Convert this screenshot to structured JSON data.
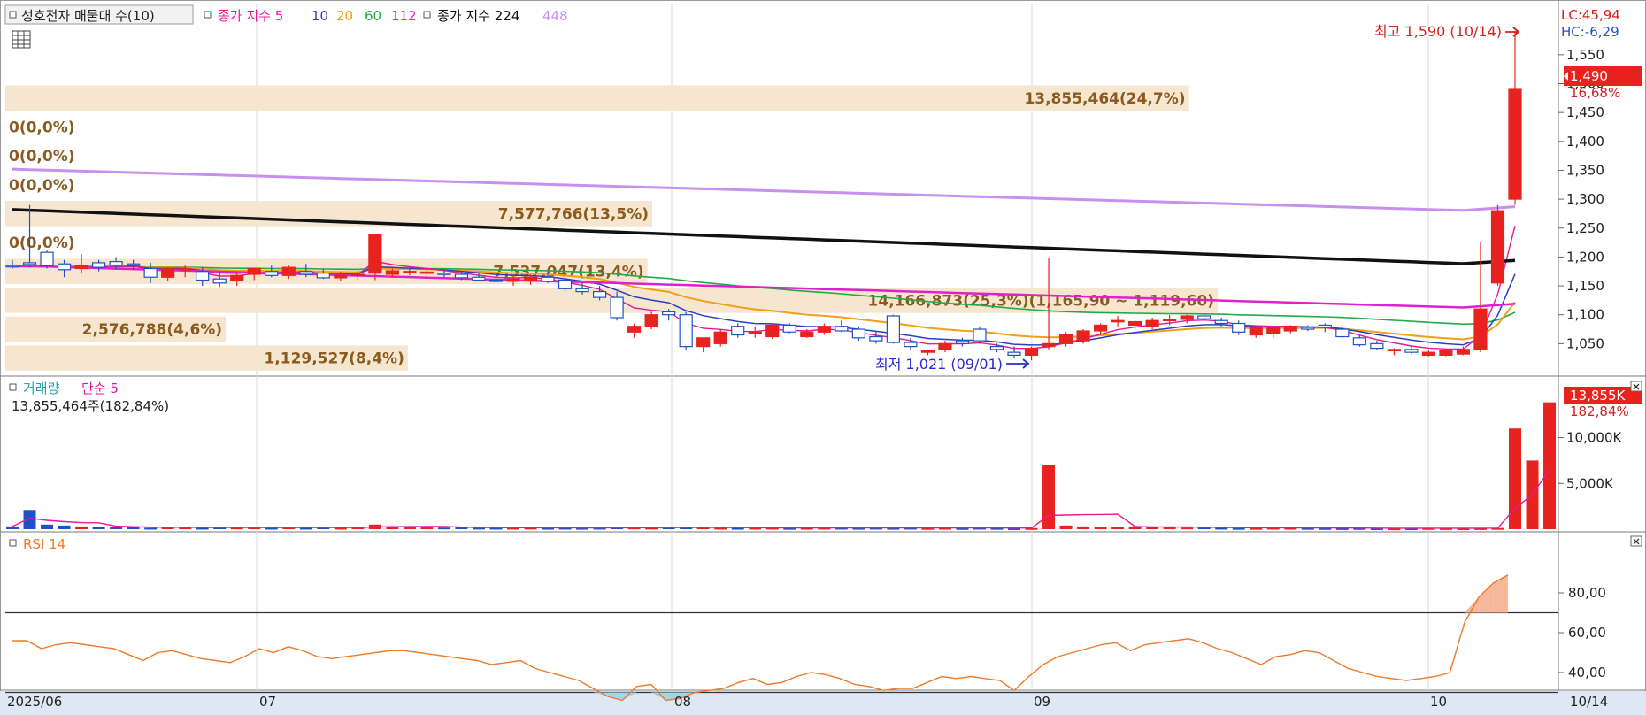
{
  "price_panel": {
    "title": "성호전자 매물대 수(10)",
    "ma_label": "종가 지수 5",
    "ma_periods": [
      "10",
      "20",
      "60",
      "112"
    ],
    "ma2_label": "종가 지수 224",
    "ma2_period": "448",
    "lc_label": "LC:45,94",
    "hc_label": "HC:-6,29",
    "current_price_label": "1,490",
    "current_change_label": "16,68%",
    "high_marker": "최고 1,590 (10/14)",
    "low_marker": "최저 1,021 (09/01)",
    "y_ticks": [
      "1,550",
      "1,500",
      "1,450",
      "1,400",
      "1,350",
      "1,300",
      "1,250",
      "1,200",
      "1,150",
      "1,100",
      "1,050"
    ]
  },
  "volume_panel": {
    "title": "거래량",
    "ma_label": "단순 5",
    "info": "13,855,464주(182,84%)",
    "current_label": "13,855K",
    "current_pct_label": "182,84%",
    "y_ticks": [
      "10,000K",
      "5,000K"
    ]
  },
  "rsi_panel": {
    "title": "RSI 14",
    "y_ticks": [
      "80,00",
      "60,00",
      "40,00"
    ]
  },
  "x_axis": {
    "labels": [
      "2025/06",
      "07",
      "08",
      "09",
      "10"
    ],
    "end_label": "10/14"
  },
  "colors": {
    "up": "#e8231f",
    "down": "#2050c8",
    "ma5": "#e8179b",
    "ma10": "#2a3fbf",
    "ma20": "#f0a018",
    "ma60": "#24a848",
    "ma112": "#e020d0",
    "ma224": "#111111",
    "ma448": "#c890ee",
    "profile": "#f6e6d0",
    "profile_text": "#8a5a1e",
    "rsi": "#f07a2a"
  },
  "chart_data": [
    {
      "type": "candlestick",
      "title": "성호전자 매물대 수(10)",
      "ylim": [
        1000,
        1600
      ],
      "x_labels": [
        "2025/06",
        "07",
        "08",
        "09",
        "10",
        "10/14"
      ],
      "candles": [
        {
          "o": 1185,
          "h": 1195,
          "l": 1180,
          "c": 1183
        },
        {
          "o": 1190,
          "h": 1290,
          "l": 1182,
          "c": 1187
        },
        {
          "o": 1208,
          "h": 1212,
          "l": 1180,
          "c": 1185
        },
        {
          "o": 1188,
          "h": 1195,
          "l": 1165,
          "c": 1178
        },
        {
          "o": 1180,
          "h": 1205,
          "l": 1172,
          "c": 1185
        },
        {
          "o": 1190,
          "h": 1195,
          "l": 1175,
          "c": 1182
        },
        {
          "o": 1192,
          "h": 1200,
          "l": 1178,
          "c": 1186
        },
        {
          "o": 1188,
          "h": 1195,
          "l": 1178,
          "c": 1185
        },
        {
          "o": 1180,
          "h": 1190,
          "l": 1155,
          "c": 1165
        },
        {
          "o": 1165,
          "h": 1182,
          "l": 1158,
          "c": 1180
        },
        {
          "o": 1178,
          "h": 1185,
          "l": 1165,
          "c": 1180
        },
        {
          "o": 1175,
          "h": 1182,
          "l": 1150,
          "c": 1160
        },
        {
          "o": 1162,
          "h": 1175,
          "l": 1148,
          "c": 1155
        },
        {
          "o": 1160,
          "h": 1172,
          "l": 1150,
          "c": 1168
        },
        {
          "o": 1170,
          "h": 1180,
          "l": 1160,
          "c": 1180
        },
        {
          "o": 1175,
          "h": 1185,
          "l": 1165,
          "c": 1168
        },
        {
          "o": 1168,
          "h": 1185,
          "l": 1162,
          "c": 1182
        },
        {
          "o": 1175,
          "h": 1188,
          "l": 1165,
          "c": 1170
        },
        {
          "o": 1172,
          "h": 1180,
          "l": 1162,
          "c": 1164
        },
        {
          "o": 1164,
          "h": 1175,
          "l": 1158,
          "c": 1168
        },
        {
          "o": 1168,
          "h": 1175,
          "l": 1160,
          "c": 1170
        },
        {
          "o": 1172,
          "h": 1180,
          "l": 1160,
          "c": 1238
        },
        {
          "o": 1170,
          "h": 1180,
          "l": 1165,
          "c": 1176
        },
        {
          "o": 1174,
          "h": 1182,
          "l": 1168,
          "c": 1175
        },
        {
          "o": 1172,
          "h": 1180,
          "l": 1166,
          "c": 1174
        },
        {
          "o": 1172,
          "h": 1178,
          "l": 1165,
          "c": 1170
        },
        {
          "o": 1170,
          "h": 1175,
          "l": 1160,
          "c": 1164
        },
        {
          "o": 1165,
          "h": 1172,
          "l": 1158,
          "c": 1160
        },
        {
          "o": 1160,
          "h": 1170,
          "l": 1155,
          "c": 1158
        },
        {
          "o": 1158,
          "h": 1168,
          "l": 1150,
          "c": 1162
        },
        {
          "o": 1160,
          "h": 1170,
          "l": 1152,
          "c": 1165
        },
        {
          "o": 1165,
          "h": 1175,
          "l": 1155,
          "c": 1158
        },
        {
          "o": 1160,
          "h": 1165,
          "l": 1140,
          "c": 1145
        },
        {
          "o": 1145,
          "h": 1155,
          "l": 1135,
          "c": 1140
        },
        {
          "o": 1140,
          "h": 1150,
          "l": 1125,
          "c": 1130
        },
        {
          "o": 1130,
          "h": 1140,
          "l": 1090,
          "c": 1095
        },
        {
          "o": 1070,
          "h": 1085,
          "l": 1060,
          "c": 1080
        },
        {
          "o": 1080,
          "h": 1105,
          "l": 1075,
          "c": 1100
        },
        {
          "o": 1105,
          "h": 1110,
          "l": 1090,
          "c": 1100
        },
        {
          "o": 1100,
          "h": 1105,
          "l": 1040,
          "c": 1045
        },
        {
          "o": 1045,
          "h": 1060,
          "l": 1035,
          "c": 1060
        },
        {
          "o": 1050,
          "h": 1075,
          "l": 1045,
          "c": 1070
        },
        {
          "o": 1080,
          "h": 1085,
          "l": 1060,
          "c": 1065
        },
        {
          "o": 1068,
          "h": 1080,
          "l": 1060,
          "c": 1070
        },
        {
          "o": 1062,
          "h": 1085,
          "l": 1058,
          "c": 1082
        },
        {
          "o": 1082,
          "h": 1085,
          "l": 1068,
          "c": 1070
        },
        {
          "o": 1062,
          "h": 1075,
          "l": 1060,
          "c": 1070
        },
        {
          "o": 1070,
          "h": 1085,
          "l": 1065,
          "c": 1080
        },
        {
          "o": 1080,
          "h": 1090,
          "l": 1070,
          "c": 1072
        },
        {
          "o": 1075,
          "h": 1080,
          "l": 1055,
          "c": 1060
        },
        {
          "o": 1062,
          "h": 1072,
          "l": 1050,
          "c": 1055
        },
        {
          "o": 1098,
          "h": 1100,
          "l": 1050,
          "c": 1052
        },
        {
          "o": 1052,
          "h": 1060,
          "l": 1040,
          "c": 1045
        },
        {
          "o": 1035,
          "h": 1040,
          "l": 1030,
          "c": 1038
        },
        {
          "o": 1040,
          "h": 1055,
          "l": 1035,
          "c": 1050
        },
        {
          "o": 1055,
          "h": 1060,
          "l": 1045,
          "c": 1050
        },
        {
          "o": 1075,
          "h": 1080,
          "l": 1050,
          "c": 1055
        },
        {
          "o": 1045,
          "h": 1050,
          "l": 1035,
          "c": 1040
        },
        {
          "o": 1035,
          "h": 1045,
          "l": 1025,
          "c": 1030
        },
        {
          "o": 1030,
          "h": 1045,
          "l": 1021,
          "c": 1042
        },
        {
          "o": 1045,
          "h": 1198,
          "l": 1040,
          "c": 1050
        },
        {
          "o": 1050,
          "h": 1070,
          "l": 1045,
          "c": 1065
        },
        {
          "o": 1055,
          "h": 1075,
          "l": 1050,
          "c": 1072
        },
        {
          "o": 1072,
          "h": 1085,
          "l": 1065,
          "c": 1082
        },
        {
          "o": 1088,
          "h": 1098,
          "l": 1080,
          "c": 1090
        },
        {
          "o": 1082,
          "h": 1090,
          "l": 1075,
          "c": 1088
        },
        {
          "o": 1080,
          "h": 1095,
          "l": 1075,
          "c": 1090
        },
        {
          "o": 1090,
          "h": 1100,
          "l": 1082,
          "c": 1092
        },
        {
          "o": 1092,
          "h": 1100,
          "l": 1085,
          "c": 1098
        },
        {
          "o": 1098,
          "h": 1102,
          "l": 1090,
          "c": 1093
        },
        {
          "o": 1090,
          "h": 1095,
          "l": 1080,
          "c": 1085
        },
        {
          "o": 1085,
          "h": 1090,
          "l": 1065,
          "c": 1070
        },
        {
          "o": 1065,
          "h": 1080,
          "l": 1060,
          "c": 1078
        },
        {
          "o": 1068,
          "h": 1080,
          "l": 1060,
          "c": 1078
        },
        {
          "o": 1072,
          "h": 1082,
          "l": 1068,
          "c": 1080
        },
        {
          "o": 1078,
          "h": 1082,
          "l": 1072,
          "c": 1075
        },
        {
          "o": 1082,
          "h": 1085,
          "l": 1070,
          "c": 1078
        },
        {
          "o": 1075,
          "h": 1080,
          "l": 1060,
          "c": 1062
        },
        {
          "o": 1060,
          "h": 1065,
          "l": 1045,
          "c": 1048
        },
        {
          "o": 1050,
          "h": 1055,
          "l": 1040,
          "c": 1042
        },
        {
          "o": 1038,
          "h": 1042,
          "l": 1030,
          "c": 1040
        },
        {
          "o": 1040,
          "h": 1045,
          "l": 1032,
          "c": 1035
        },
        {
          "o": 1030,
          "h": 1038,
          "l": 1028,
          "c": 1035
        },
        {
          "o": 1030,
          "h": 1040,
          "l": 1028,
          "c": 1038
        },
        {
          "o": 1032,
          "h": 1045,
          "l": 1030,
          "c": 1040
        },
        {
          "o": 1040,
          "h": 1225,
          "l": 1035,
          "c": 1110
        },
        {
          "o": 1155,
          "h": 1290,
          "l": 1150,
          "c": 1280
        },
        {
          "o": 1300,
          "h": 1590,
          "l": 1290,
          "c": 1490
        }
      ],
      "profile": [
        {
          "range": [
            1000,
            1050
          ],
          "volume": "1,129,527",
          "pct": "(8,4%)"
        },
        {
          "range": [
            1050,
            1100
          ],
          "volume": "2,576,788",
          "pct": "(4,6%)"
        },
        {
          "range": [
            1100,
            1150
          ],
          "volume": "14,166,873",
          "pct": "(25,3%)(1,165,90 ~ 1,119,60)"
        },
        {
          "range": [
            1150,
            1200
          ],
          "volume": "7,537,047",
          "pct": "(13,4%)"
        },
        {
          "range": [
            1200,
            1250
          ],
          "volume": "0",
          "pct": "(0,0%)"
        },
        {
          "range": [
            1250,
            1300
          ],
          "volume": "7,577,766",
          "pct": "(13,5%)"
        },
        {
          "range": [
            1300,
            1350
          ],
          "volume": "0",
          "pct": "(0,0%)"
        },
        {
          "range": [
            1350,
            1400
          ],
          "volume": "0",
          "pct": "(0,0%)"
        },
        {
          "range": [
            1400,
            1450
          ],
          "volume": "0",
          "pct": "(0,0%)"
        },
        {
          "range": [
            1450,
            1500
          ],
          "volume": "13,855,464",
          "pct": "(24,7%)"
        }
      ]
    },
    {
      "type": "bar",
      "title": "거래량",
      "unit": "K",
      "ylim": [
        0,
        14500
      ],
      "values": [
        300,
        2100,
        500,
        400,
        300,
        200,
        250,
        200,
        150,
        250,
        200,
        150,
        200,
        180,
        200,
        150,
        200,
        150,
        200,
        150,
        200,
        500,
        300,
        250,
        200,
        180,
        200,
        160,
        150,
        150,
        160,
        140,
        150,
        140,
        150,
        200,
        180,
        160,
        200,
        200,
        200,
        150,
        140,
        150,
        150,
        130,
        140,
        150,
        150,
        140,
        150,
        140,
        150,
        130,
        140,
        120,
        150,
        130,
        100,
        120,
        7000,
        400,
        300,
        200,
        250,
        300,
        220,
        200,
        180,
        200,
        150,
        130,
        130,
        150,
        140,
        130,
        120,
        110,
        120,
        100,
        90,
        100,
        120,
        110,
        100,
        110,
        130,
        11000,
        7500,
        13855
      ]
    },
    {
      "type": "line",
      "title": "RSI 14",
      "ylim": [
        23,
        96
      ],
      "values": [
        56,
        56,
        52,
        54,
        55,
        54,
        53,
        52,
        49,
        46,
        50,
        51,
        49,
        47,
        46,
        45,
        48,
        52,
        50,
        53,
        51,
        48,
        47,
        48,
        49,
        50,
        51,
        51,
        50,
        49,
        48,
        47,
        46,
        44,
        45,
        46,
        42,
        40,
        38,
        36,
        32,
        28,
        26,
        33,
        34,
        26,
        27,
        30,
        31,
        32,
        35,
        37,
        34,
        35,
        38,
        40,
        39,
        37,
        34,
        33,
        31,
        32,
        32,
        35,
        38,
        37,
        38,
        37,
        36,
        31,
        38,
        44,
        48,
        50,
        52,
        54,
        55,
        51,
        54,
        55,
        56,
        57,
        55,
        52,
        50,
        47,
        44,
        48,
        49,
        51,
        50,
        46,
        42,
        40,
        38,
        37,
        36,
        37,
        38,
        40,
        65,
        78,
        85,
        89
      ]
    }
  ]
}
